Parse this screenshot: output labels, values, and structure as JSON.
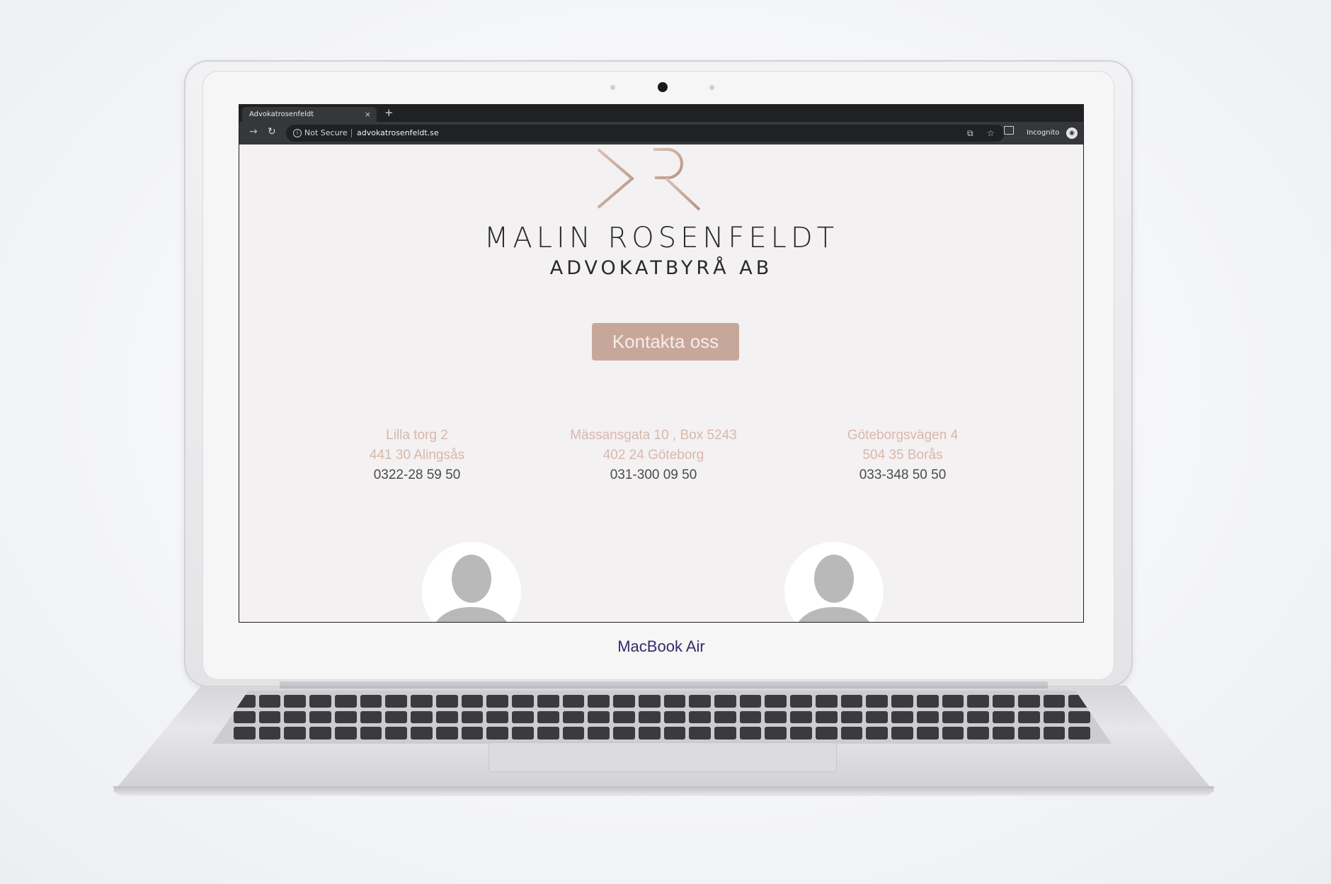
{
  "device": {
    "brand_label_bold": "MacBook",
    "brand_label_rest": " Air"
  },
  "browser": {
    "tab_title": "Advokatrosenfeldt",
    "tab_close": "×",
    "new_tab": "+",
    "security_label": "Not Secure",
    "url": "advokatrosenfeldt.se",
    "profile_label": "Incognito"
  },
  "page": {
    "firm_name": "MALIN ROSENFELDT",
    "firm_subtitle": "ADVOKATBYRÅ AB",
    "cta_label": "Kontakta oss",
    "brand_color": "#c8a79b",
    "offices": [
      {
        "street": "Lilla torg 2",
        "city": "441 30 Alingsås",
        "phone": "0322-28 59 50"
      },
      {
        "street": "Mässansgata 10 , Box 5243",
        "city": "402 24 Göteborg",
        "phone": "031-300 09 50"
      },
      {
        "street": "Göteborgsvägen 4",
        "city": "504 35 Borås",
        "phone": "033-348 50 50"
      }
    ]
  }
}
